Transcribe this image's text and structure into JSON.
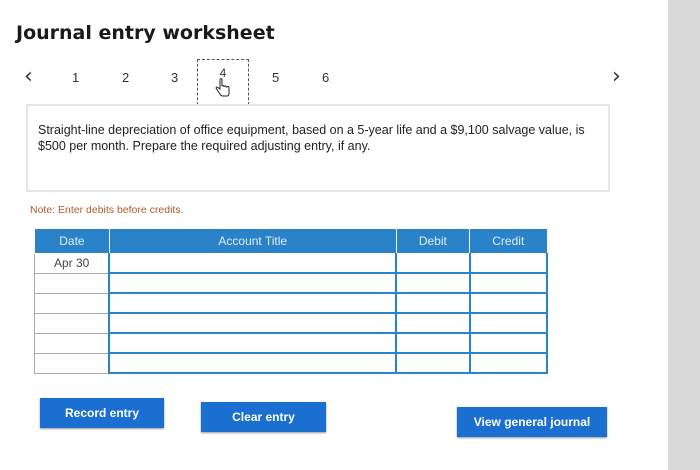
{
  "title": "Journal entry worksheet",
  "steps": [
    "1",
    "2",
    "3",
    "4",
    "5",
    "6"
  ],
  "active_step": "4",
  "instruction": "Straight-line depreciation of office equipment, based on a 5-year life and a $9,100 salvage value, is $500 per month. Prepare the required adjusting entry, if any.",
  "note": "Note: Enter debits before credits.",
  "table": {
    "headers": {
      "date": "Date",
      "account": "Account Title",
      "debit": "Debit",
      "credit": "Credit"
    },
    "rows": [
      {
        "date": "Apr 30",
        "account": "",
        "debit": "",
        "credit": ""
      },
      {
        "date": "",
        "account": "",
        "debit": "",
        "credit": ""
      },
      {
        "date": "",
        "account": "",
        "debit": "",
        "credit": ""
      },
      {
        "date": "",
        "account": "",
        "debit": "",
        "credit": ""
      },
      {
        "date": "",
        "account": "",
        "debit": "",
        "credit": ""
      },
      {
        "date": "",
        "account": "",
        "debit": "",
        "credit": ""
      }
    ]
  },
  "buttons": {
    "record": "Record entry",
    "clear": "Clear entry",
    "view": "View general journal"
  },
  "icons": {
    "prev": "chevron-left-icon",
    "next": "chevron-right-icon",
    "cursor": "hand-pointer-icon"
  },
  "colors": {
    "accent": "#1a6fd0",
    "table_header": "#2a82c9",
    "note": "#b05a2a"
  }
}
